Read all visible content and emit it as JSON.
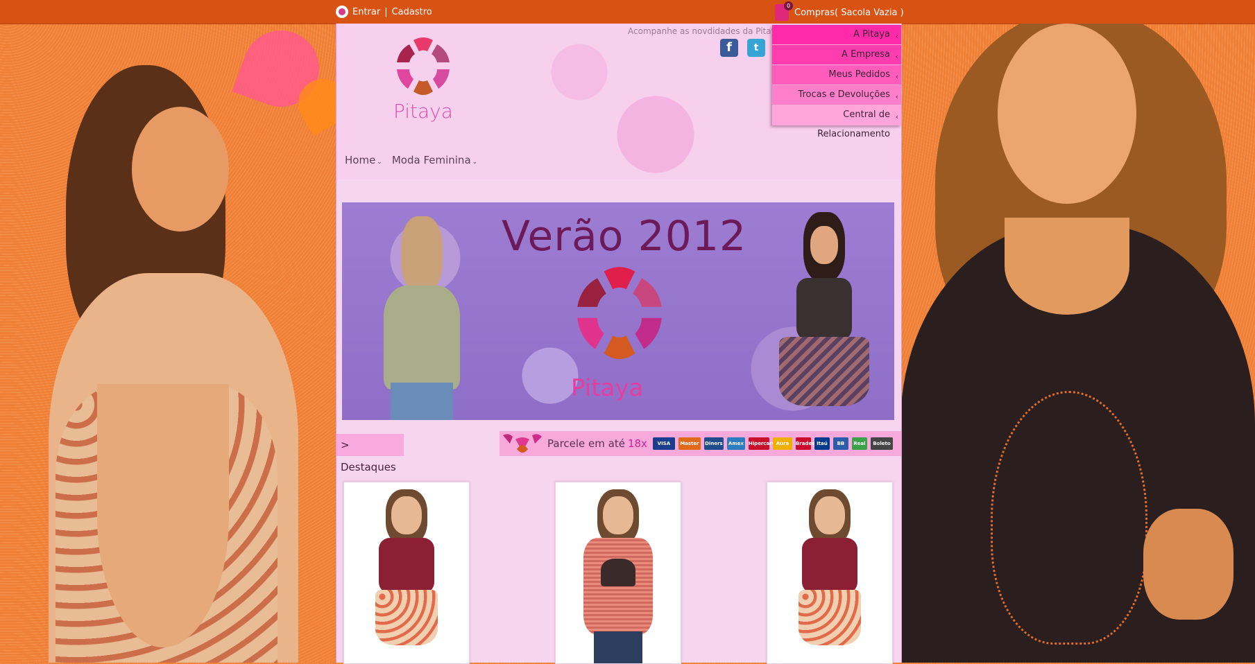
{
  "topbar": {
    "login_label": "Entrar",
    "separator": "|",
    "register_label": "Cadastro",
    "cart_label": "Compras( Sacola Vazia )",
    "cart_count": "0"
  },
  "header": {
    "brand": "Pitaya",
    "follow_text": "Acompanhe as novdidades da Pitaya"
  },
  "nav": {
    "items": [
      {
        "label": "Home"
      },
      {
        "label": "Moda Feminina"
      }
    ]
  },
  "dropdown": {
    "items": [
      {
        "label": "A Pitaya"
      },
      {
        "label": "A Empresa"
      },
      {
        "label": "Meus Pedidos"
      },
      {
        "label": "Trocas e Devoluções"
      },
      {
        "label": "Central de Relacionamento"
      }
    ]
  },
  "banner": {
    "title": "Verão 2012",
    "brand": "Pitaya"
  },
  "section": {
    "destaques_label": "> Destaques"
  },
  "payment": {
    "text": "Parcele em até",
    "installments": "18x",
    "cards": [
      {
        "name": "VISA",
        "color": "#1a3d8f"
      },
      {
        "name": "Master",
        "color": "#e06a1a"
      },
      {
        "name": "Diners",
        "color": "#1f4c8c"
      },
      {
        "name": "Amex",
        "color": "#2f7bbf"
      },
      {
        "name": "Hipercard",
        "color": "#c8102e"
      },
      {
        "name": "Aura",
        "color": "#f0b000"
      },
      {
        "name": "Bradesco",
        "color": "#cc092f"
      },
      {
        "name": "Itaú",
        "color": "#003a8c"
      },
      {
        "name": "BB",
        "color": "#2c5da8"
      },
      {
        "name": "Real",
        "color": "#3aa34a"
      },
      {
        "name": "Boleto",
        "color": "#444444"
      }
    ]
  },
  "colors": {
    "topbar": "#d85214",
    "main_bg": "#f6d5ee",
    "accent_pink": "#ff2aa8"
  }
}
